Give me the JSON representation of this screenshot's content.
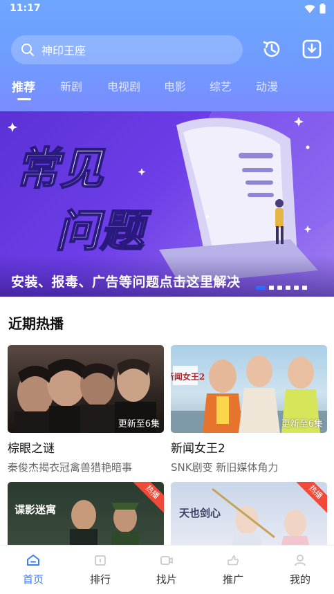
{
  "status_bar": {
    "time": "11:17"
  },
  "search": {
    "text": "神印王座"
  },
  "tabs": [
    {
      "label": "推荐",
      "active": true
    },
    {
      "label": "新剧"
    },
    {
      "label": "电视剧"
    },
    {
      "label": "电影"
    },
    {
      "label": "综艺"
    },
    {
      "label": "动漫"
    }
  ],
  "banner": {
    "caption": "安装、报毒、广告等问题点击这里解决",
    "art_text_line1": "常见",
    "art_text_line2": "问题",
    "slide_count": 6,
    "active_slide": 1
  },
  "section": {
    "title": "近期热播"
  },
  "cards": [
    {
      "title": "棕眼之谜",
      "desc": "秦俊杰揭衣冠禽兽猎艳暗事",
      "badge": "更新至6集"
    },
    {
      "title": "新闻女王2",
      "desc": "SNK剧变 新旧媒体角力",
      "badge": "更新至6集",
      "poster_logo": "新闻女王2"
    },
    {
      "title": "",
      "desc": "",
      "badge": "",
      "corner_tag": "热播",
      "poster_logo": "谍影迷寓"
    },
    {
      "title": "",
      "desc": "",
      "badge": "",
      "corner_tag": "热播",
      "poster_logo": "天也剑心"
    }
  ],
  "bottom_nav": [
    {
      "label": "首页",
      "active": true,
      "icon": "home-icon"
    },
    {
      "label": "排行",
      "icon": "ranking-icon"
    },
    {
      "label": "找片",
      "icon": "video-icon"
    },
    {
      "label": "推广",
      "icon": "share-icon"
    },
    {
      "label": "我的",
      "icon": "user-icon"
    }
  ],
  "colors": {
    "accent": "#3d7bff",
    "header_top": "#6ea6ff",
    "banner": "#5b31d6",
    "hot_tag": "#f04a3a"
  }
}
